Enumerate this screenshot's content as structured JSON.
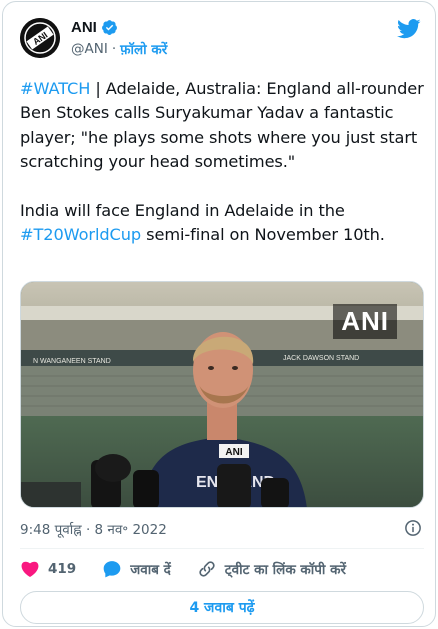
{
  "author": {
    "display_name": "ANI",
    "handle": "@ANI",
    "separator": "·",
    "follow_label": "फ़ॉलो करें",
    "avatar_text": "ANI"
  },
  "tweet": {
    "paragraph1": {
      "hashtag": "#WATCH",
      "text": " | Adelaide, Australia: England all-rounder Ben Stokes calls Suryakumar Yadav a fantastic player; \"he plays some shots where you just start scratching your head sometimes.\""
    },
    "paragraph2": {
      "before": "India will face England in Adelaide in the ",
      "hashtag": "#T20WorldCup",
      "after": " semi-final on November 10th."
    }
  },
  "media": {
    "watermark": "ANI",
    "mic_label": "ANI",
    "stand_text_left": "N WANGANEEN STAND",
    "stand_text_right": "JACK DAWSON STAND",
    "shirt_text": "ENGLAND"
  },
  "meta": {
    "timestamp": "9:48 पूर्वाह्न · 8 नव॰ 2022"
  },
  "actions": {
    "like_count": "419",
    "reply_label": "जवाब दें",
    "copy_link_label": "ट्वीट का लिंक कॉपी करें"
  },
  "replies_button": "4 जवाब पढ़ें",
  "colors": {
    "accent": "#1d9bf0",
    "like": "#f91880",
    "muted": "#536471"
  }
}
